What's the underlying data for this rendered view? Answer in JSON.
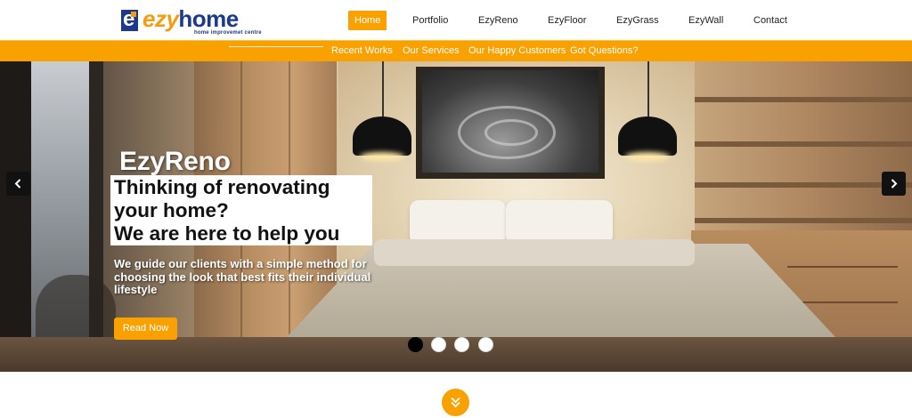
{
  "brand": {
    "logo_letter": "e",
    "name_part1": "ezy",
    "name_part2": "home",
    "tagline": "home improvemet centre"
  },
  "nav": {
    "items": [
      "Home",
      "Portfolio",
      "EzyReno",
      "EzyFloor",
      "EzyGrass",
      "EzyWall",
      "Contact"
    ],
    "active": "Home"
  },
  "subnav": {
    "items": [
      "Recent Works",
      "Our Services",
      "Our Happy Customers",
      "Got Questions?"
    ]
  },
  "hero": {
    "title": "EzyReno",
    "headline_lines": [
      "Thinking of renovating",
      "your home?",
      "We are here to help you"
    ],
    "subtext": "We guide our clients with a simple method for choosing the look that best fits their individual lifestyle",
    "button_label": "Read Now",
    "slides_count": 4,
    "active_slide": 1
  },
  "icons": {
    "prev": "chevron-left-icon",
    "next": "chevron-right-icon",
    "scroll": "double-chevron-down-icon"
  },
  "colors": {
    "accent": "#f9a100",
    "brand_blue": "#1b3a8c",
    "brand_orange": "#f39c12"
  }
}
